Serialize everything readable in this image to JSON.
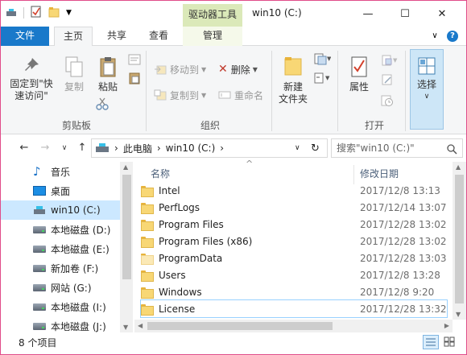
{
  "titlebar": {
    "context_tab": "驱动器工具",
    "title": "win10 (C:)",
    "min": "—",
    "max": "☐",
    "close": "✕"
  },
  "tabs": {
    "file": "文件",
    "home": "主页",
    "share": "共享",
    "view": "查看",
    "manage": "管理",
    "collapse": "∨",
    "help": "?"
  },
  "ribbon": {
    "pin": "固定到\"快速访问\"",
    "copy": "复制",
    "paste": "粘贴",
    "group_clipboard": "剪贴板",
    "move_to": "移动到",
    "copy_to": "复制到",
    "delete": "删除",
    "rename": "重命名",
    "group_organize": "组织",
    "new_folder": "新建\n文件夹",
    "properties": "属性",
    "group_open": "打开",
    "select": "选择"
  },
  "address": {
    "back": "←",
    "forward": "→",
    "recent": "∨",
    "up": "↑",
    "crumbs": [
      "此电脑",
      "win10 (C:)"
    ],
    "sep": "›",
    "dropdown": "∨",
    "refresh": "↻",
    "search_placeholder": "搜索\"win10 (C:)\""
  },
  "nav": [
    {
      "label": "音乐",
      "icon": "music-icon"
    },
    {
      "label": "桌面",
      "icon": "desktop-icon"
    },
    {
      "label": "win10 (C:)",
      "icon": "drive-icon",
      "selected": true
    },
    {
      "label": "本地磁盘 (D:)",
      "icon": "drive-icon"
    },
    {
      "label": "本地磁盘 (E:)",
      "icon": "drive-icon"
    },
    {
      "label": "新加卷 (F:)",
      "icon": "drive-icon"
    },
    {
      "label": "网站 (G:)",
      "icon": "drive-icon"
    },
    {
      "label": "本地磁盘 (I:)",
      "icon": "drive-icon"
    },
    {
      "label": "本地磁盘 (J:)",
      "icon": "drive-icon"
    }
  ],
  "columns": {
    "name": "名称",
    "date": "修改日期",
    "sort": "^"
  },
  "files": [
    {
      "name": "Intel",
      "date": "2017/12/8 13:13"
    },
    {
      "name": "PerfLogs",
      "date": "2017/12/14 13:07"
    },
    {
      "name": "Program Files",
      "date": "2017/12/28 13:02"
    },
    {
      "name": "Program Files (x86)",
      "date": "2017/12/28 13:02"
    },
    {
      "name": "ProgramData",
      "date": "2017/12/28 13:03"
    },
    {
      "name": "Users",
      "date": "2017/12/8 13:28"
    },
    {
      "name": "Windows",
      "date": "2017/12/8 9:20"
    },
    {
      "name": "License",
      "date": "2017/12/28 13:32"
    }
  ],
  "status": {
    "count": "8 个项目"
  }
}
